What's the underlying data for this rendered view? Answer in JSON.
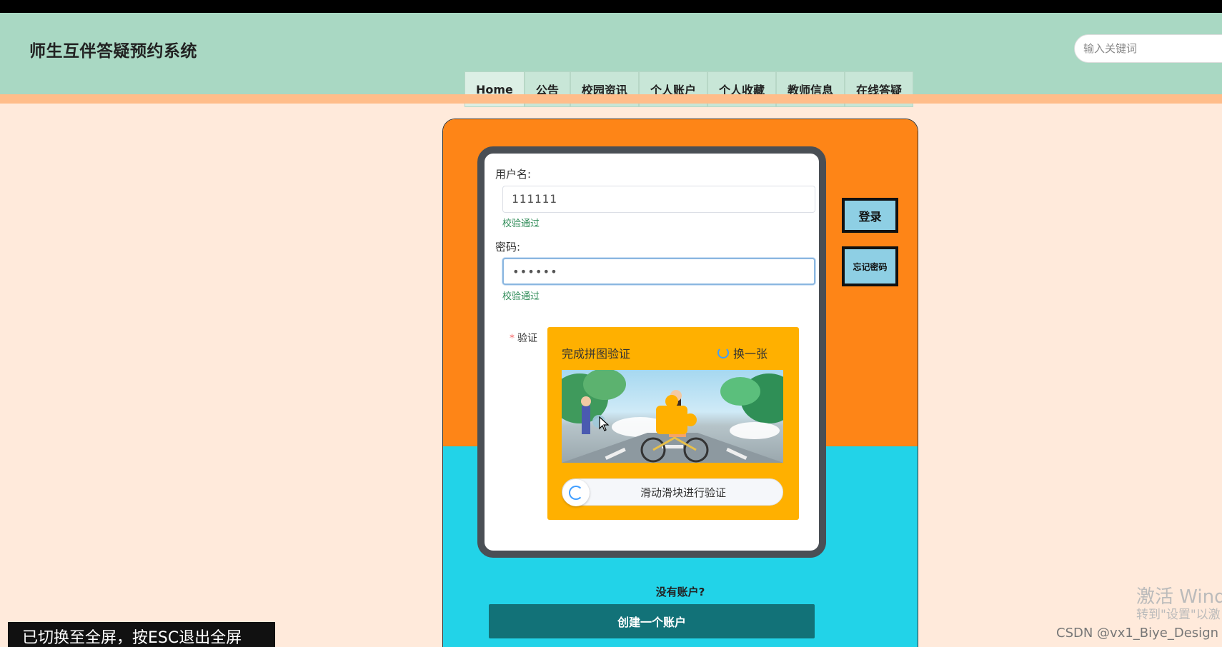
{
  "header": {
    "site_title": "师生互伴答疑预约系统",
    "search_placeholder": "输入关键词"
  },
  "nav": {
    "items": [
      {
        "label": "Home"
      },
      {
        "label": "公告"
      },
      {
        "label": "校园资讯"
      },
      {
        "label": "个人账户"
      },
      {
        "label": "个人收藏"
      },
      {
        "label": "教师信息"
      },
      {
        "label": "在线答疑"
      }
    ]
  },
  "login_form": {
    "username_label": "用户名:",
    "username_value": "111111",
    "username_status": "校验通过",
    "password_label": "密码:",
    "password_value": "••••••",
    "password_status": "校验通过",
    "verify_label": "验证",
    "captcha": {
      "title": "完成拼图验证",
      "refresh_label": "换一张",
      "slider_text": "滑动滑块进行验证"
    }
  },
  "buttons": {
    "login": "登录",
    "forgot_password": "忘记密码",
    "create_account": "创建一个账户"
  },
  "no_account_text": "没有账户?",
  "overlay": {
    "fullscreen_toast": "已切换至全屏，按ESC退出全屏",
    "windows_watermark_line1": "激活 Wind",
    "windows_watermark_line2": "转到\"设置\"以激",
    "csdn_watermark": "CSDN @vx1_Biye_Design"
  },
  "colors": {
    "header_bg": "#a9d8c3",
    "page_bg": "#ffeadb",
    "panel_top": "#fe8517",
    "panel_bottom": "#22d3e8",
    "captcha_bg": "#ffb000",
    "create_button": "#127278",
    "side_button": "#8ecfe4",
    "success_text": "#2e8b57"
  }
}
